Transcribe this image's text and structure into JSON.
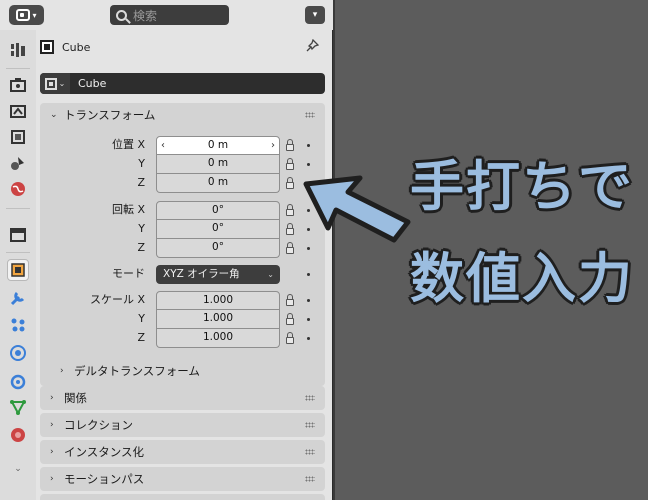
{
  "header": {
    "search_placeholder": "検索"
  },
  "context": {
    "object_name": "Cube",
    "name_field_value": "Cube"
  },
  "transform": {
    "title": "トランスフォーム",
    "location_label": "位置 X",
    "location": [
      "0 m",
      "0 m",
      "0 m"
    ],
    "rotation_label": "回転 X",
    "rotation": [
      "0°",
      "0°",
      "0°"
    ],
    "mode_label": "モード",
    "mode_value": "XYZ オイラー角",
    "scale_label": "スケール X",
    "scale": [
      "1.000",
      "1.000",
      "1.000"
    ],
    "axis_y": "Y",
    "axis_z": "Z",
    "delta_title": "デルタトランスフォーム"
  },
  "panels": [
    {
      "title": "関係"
    },
    {
      "title": "コレクション"
    },
    {
      "title": "インスタンス化"
    },
    {
      "title": "モーションパス"
    }
  ],
  "annotation": {
    "line1": "手打ちで",
    "line2": "数値入力",
    "color": "#9bbde0"
  },
  "tab_icons": [
    "tool-icon",
    "render-icon",
    "output-icon",
    "view-layer-icon",
    "scene-icon",
    "world-icon",
    "collection-icon",
    "object-icon",
    "modifier-icon",
    "particles-icon",
    "physics-icon",
    "constraints-icon",
    "object-data-icon",
    "material-icon"
  ]
}
